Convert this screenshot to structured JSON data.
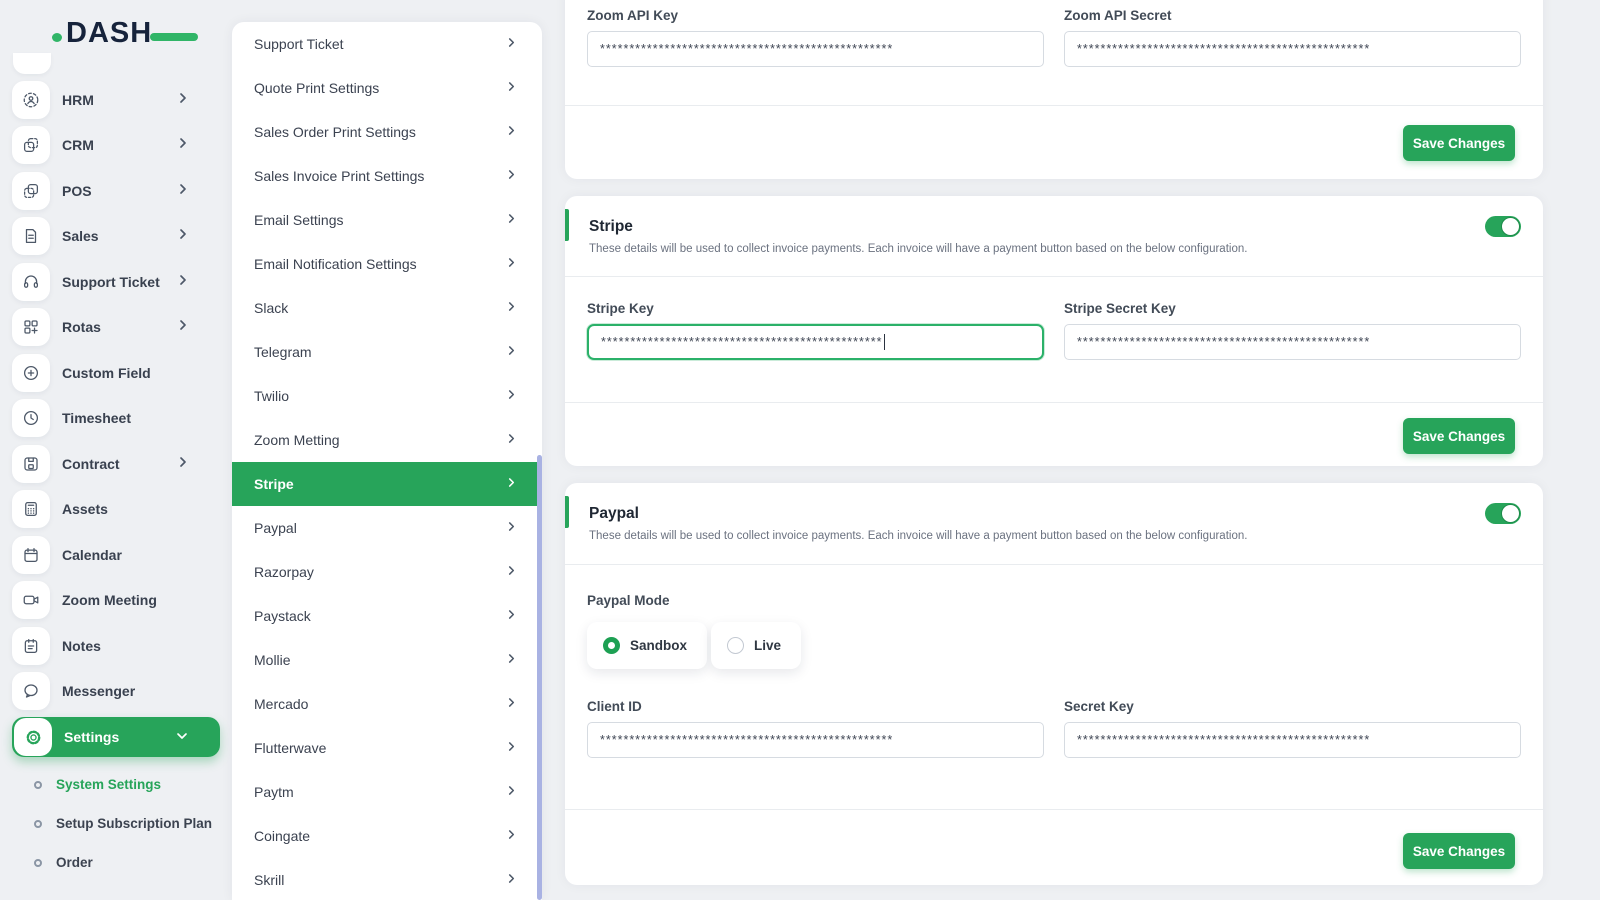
{
  "brand": {
    "name": "DASH"
  },
  "sidebar": {
    "items": [
      {
        "label": "HRM"
      },
      {
        "label": "CRM"
      },
      {
        "label": "POS"
      },
      {
        "label": "Sales"
      },
      {
        "label": "Support Ticket"
      },
      {
        "label": "Rotas"
      },
      {
        "label": "Custom Field"
      },
      {
        "label": "Timesheet"
      },
      {
        "label": "Contract"
      },
      {
        "label": "Assets"
      },
      {
        "label": "Calendar"
      },
      {
        "label": "Zoom Meeting"
      },
      {
        "label": "Notes"
      },
      {
        "label": "Messenger"
      }
    ],
    "settings_label": "Settings",
    "sub_items": [
      {
        "label": "System Settings"
      },
      {
        "label": "Setup Subscription Plan"
      },
      {
        "label": "Order"
      }
    ]
  },
  "settings_nav": {
    "active_item": "Stripe",
    "items": [
      "Support Ticket",
      "Quote Print Settings",
      "Sales Order Print Settings",
      "Sales Invoice Print Settings",
      "Email Settings",
      "Email Notification Settings",
      "Slack",
      "Telegram",
      "Twilio",
      "Zoom Metting",
      "Stripe",
      "Paypal",
      "Razorpay",
      "Paystack",
      "Mollie",
      "Mercado",
      "Flutterwave",
      "Paytm",
      "Coingate",
      "Skrill"
    ]
  },
  "zoom_section": {
    "api_key_label": "Zoom API Key",
    "api_key_value": "**************************************************",
    "api_secret_label": "Zoom API Secret",
    "api_secret_value": "**************************************************",
    "save_label": "Save Changes"
  },
  "stripe_section": {
    "title": "Stripe",
    "description": "These details will be used to collect invoice payments. Each invoice will have a payment button based on the below configuration.",
    "enabled": true,
    "key_label": "Stripe Key",
    "key_value": "************************************************",
    "secret_label": "Stripe Secret Key",
    "secret_value": "**************************************************",
    "save_label": "Save Changes"
  },
  "paypal_section": {
    "title": "Paypal",
    "description": "These details will be used to collect invoice payments. Each invoice will have a payment button based on the below configuration.",
    "enabled": true,
    "mode_label": "Paypal Mode",
    "modes": [
      {
        "label": "Sandbox",
        "selected": true
      },
      {
        "label": "Live",
        "selected": false
      }
    ],
    "client_id_label": "Client ID",
    "client_id_value": "**************************************************",
    "secret_key_label": "Secret Key",
    "secret_key_value": "**************************************************",
    "save_label": "Save Changes"
  },
  "colors": {
    "primary_green": "#27a45a",
    "logo_green": "#30b567",
    "logo_navy": "#16233b",
    "page_bg": "#eef0f3",
    "scroll_thumb": "#a9b2e3"
  }
}
